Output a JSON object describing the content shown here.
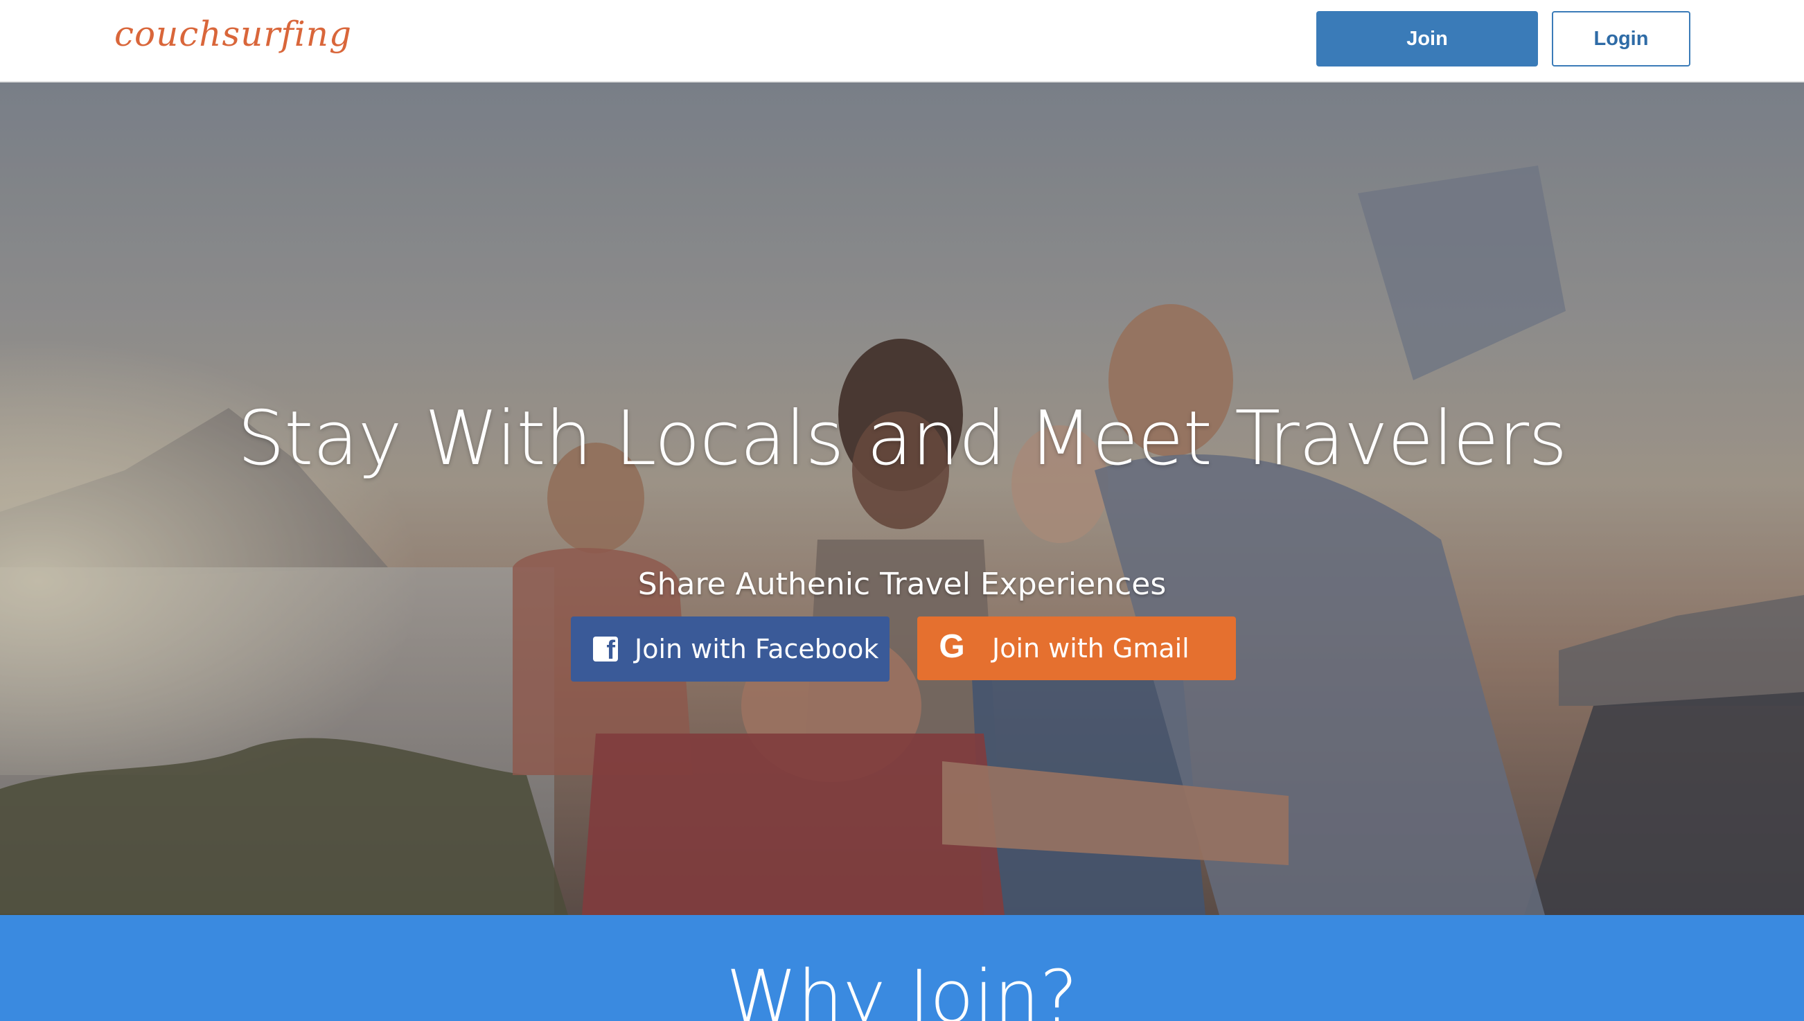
{
  "header": {
    "logo_text": "couchsurfing",
    "join_label": "Join",
    "login_label": "Login"
  },
  "hero": {
    "title": "Stay With Locals and Meet Travelers",
    "subtitle": "Share Authenic Travel Experiences",
    "facebook_button": {
      "label": "Join with Facebook",
      "icon": "facebook-icon",
      "color": "#3a5a98"
    },
    "gmail_button": {
      "label": "Join with Gmail",
      "icon": "google-icon",
      "color": "#e5702f"
    }
  },
  "why_join": {
    "title": "Why Join?"
  },
  "colors": {
    "brand": "#d9663a",
    "primary": "#3a7bb8",
    "band": "#3a8ae0"
  }
}
